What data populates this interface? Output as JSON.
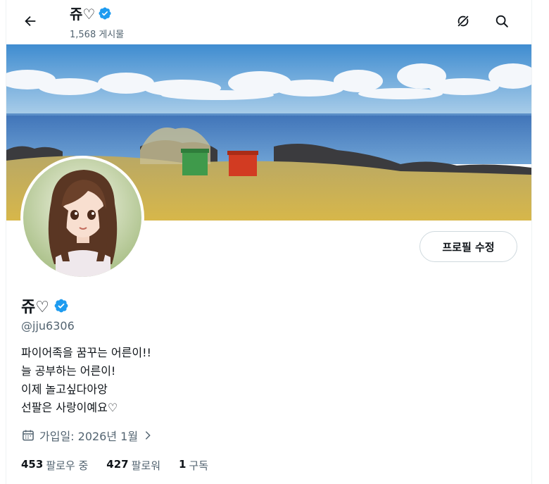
{
  "header": {
    "name": "쥬♡",
    "post_count": "1,568 게시물"
  },
  "profile": {
    "name": "쥬♡",
    "handle": "@jju6306",
    "edit_button": "프로필 수정",
    "bio": [
      "파이어족을 꿈꾸는 어른이!!",
      "늘 공부하는 어른이!",
      "이제 놀고싶다아앙",
      "선팔은 사랑이예요♡"
    ],
    "joined": "가입일: 2026년 1월"
  },
  "stats": {
    "following_count": "453",
    "following_label": "팔로우 중",
    "followers_count": "427",
    "followers_label": "팔로워",
    "subscriptions_count": "1",
    "subscriptions_label": "구독"
  },
  "colors": {
    "verified": "#1d9bf0",
    "secondary_text": "#536471",
    "border": "#cfd9de"
  }
}
